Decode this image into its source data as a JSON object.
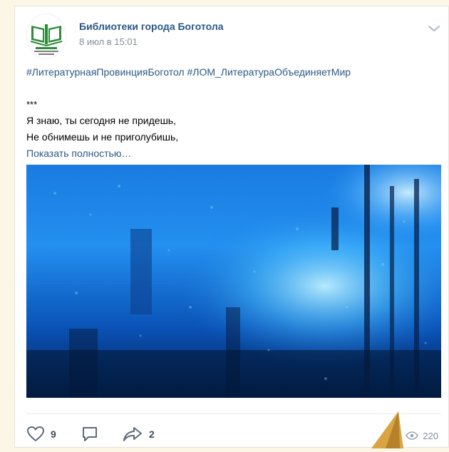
{
  "post": {
    "author": "Библиотеки города Боготола",
    "date": "8 июл в 15:01",
    "hashtags": "#ЛитературнаяПровинцияБоготол #ЛОМ_ЛитератураОбъединяетМир",
    "separator": "***",
    "line1": "Я знаю, ты сегодня не придешь,",
    "line2": "Не обнимешь и не приголубишь,",
    "show_more": "Показать полностью…"
  },
  "actions": {
    "likes": "9",
    "shares": "2",
    "views": "220"
  },
  "colors": {
    "link": "#2a5885",
    "muted": "#818c99",
    "photo_base": "#0a4fb0",
    "logo_green": "#2e8b3a"
  },
  "icons": {
    "avatar": "library-logo-icon",
    "menu": "chevron-down-icon",
    "like": "heart-icon",
    "comment": "comment-icon",
    "share": "share-arrow-icon",
    "views": "eye-icon"
  }
}
